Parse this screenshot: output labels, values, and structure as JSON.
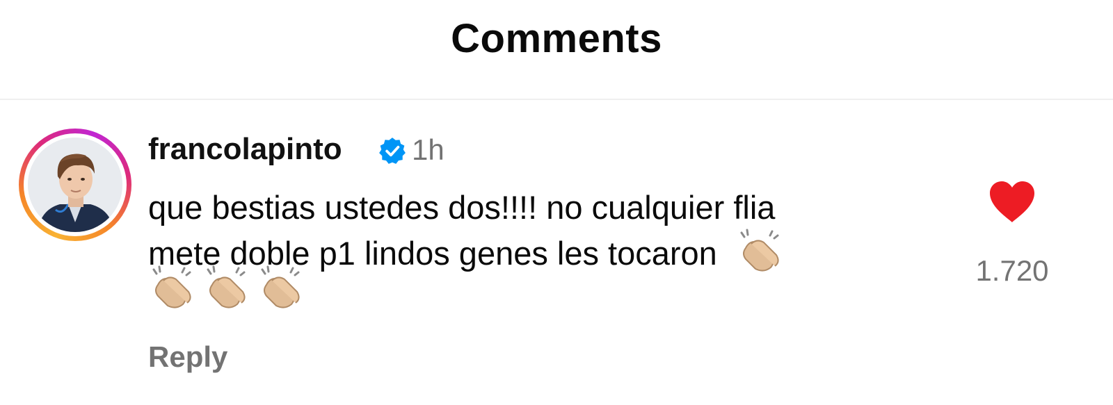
{
  "header": {
    "title": "Comments"
  },
  "comment": {
    "avatar_icon": "profile-photo",
    "username": "francolapinto",
    "verified_icon": "verified-badge-icon",
    "timestamp": "1h",
    "text_line1": "que bestias ustedes dos!!!! no cualquier flia",
    "text_line2": "mete doble p1 lindos genes les tocaron",
    "emoji": "clapping-hands",
    "reply_label": "Reply",
    "like_icon": "heart-icon",
    "like_count": "1.720"
  },
  "colors": {
    "heart": "#ed1c24",
    "verified": "#0095f6",
    "muted_text": "#737373",
    "ring_gradient": [
      "#f9b233",
      "#f58529",
      "#dd2a7b",
      "#c026d3"
    ]
  }
}
